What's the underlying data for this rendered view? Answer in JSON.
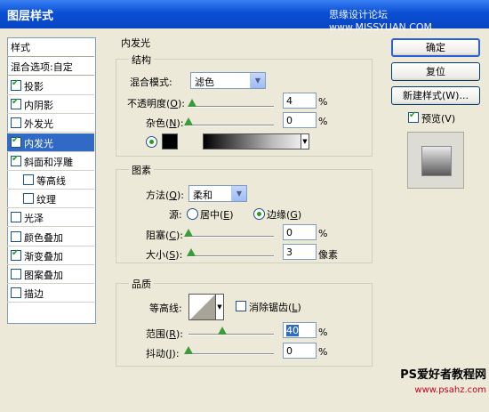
{
  "window": {
    "title": "图层样式",
    "watermark": "思缘设计论坛 www.MISSYUAN.COM"
  },
  "left_panel": {
    "header": "样式",
    "blend_options": "混合选项:自定",
    "items": [
      {
        "label": "投影",
        "checked": true,
        "indent": false,
        "selected": false
      },
      {
        "label": "内阴影",
        "checked": true,
        "indent": false,
        "selected": false
      },
      {
        "label": "外发光",
        "checked": false,
        "indent": false,
        "selected": false
      },
      {
        "label": "内发光",
        "checked": true,
        "indent": false,
        "selected": true
      },
      {
        "label": "斜面和浮雕",
        "checked": true,
        "indent": false,
        "selected": false
      },
      {
        "label": "等高线",
        "checked": false,
        "indent": true,
        "selected": false
      },
      {
        "label": "纹理",
        "checked": false,
        "indent": true,
        "selected": false
      },
      {
        "label": "光泽",
        "checked": false,
        "indent": false,
        "selected": false
      },
      {
        "label": "颜色叠加",
        "checked": false,
        "indent": false,
        "selected": false
      },
      {
        "label": "渐变叠加",
        "checked": true,
        "indent": false,
        "selected": false
      },
      {
        "label": "图案叠加",
        "checked": false,
        "indent": false,
        "selected": false
      },
      {
        "label": "描边",
        "checked": false,
        "indent": false,
        "selected": false
      }
    ]
  },
  "panel_title": "内发光",
  "structure": {
    "title": "结构",
    "blend_mode_label": "混合模式:",
    "blend_mode_value": "滤色",
    "opacity_label": "不透明度(",
    "opacity_key": "O",
    "opacity_value": "4",
    "noise_label": "杂色(",
    "noise_key": "N",
    "noise_value": "0",
    "percent": "%",
    "close_paren": "):"
  },
  "elements": {
    "title": "图素",
    "method_label": "方法(",
    "method_key": "Q",
    "method_value": "柔和",
    "source_label": "源:",
    "source_center": "居中(",
    "source_center_key": "E",
    "source_edge": "边缘(",
    "source_edge_key": "G",
    "choke_label": "阻塞(",
    "choke_key": "C",
    "choke_value": "0",
    "size_label": "大小(",
    "size_key": "S",
    "size_value": "3",
    "size_unit": "像素"
  },
  "quality": {
    "title": "品质",
    "contour_label": "等高线:",
    "antialias_label": "消除锯齿(",
    "antialias_key": "L",
    "range_label": "范围(",
    "range_key": "R",
    "range_value": "40",
    "jitter_label": "抖动(",
    "jitter_key": "J",
    "jitter_value": "0"
  },
  "buttons": {
    "ok": "确定",
    "reset": "复位",
    "new_style": "新建样式(W)...",
    "preview_label": "预览(V)"
  },
  "levels": {
    "opacity": 0.04,
    "noise": 0,
    "choke": 0,
    "size": 0.03,
    "range": 0.4,
    "jitter": 0
  },
  "brand": {
    "line1": "PS爱好者教程网",
    "line2": "www.psahz.com"
  }
}
